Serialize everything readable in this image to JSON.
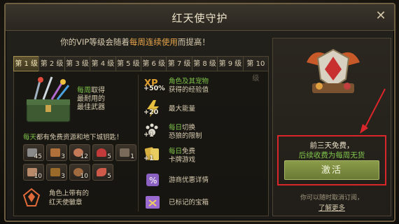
{
  "window": {
    "title": "红天使守护"
  },
  "subtitle": {
    "prefix": "你的VIP等级会随着",
    "highlight": "每周连续使用",
    "suffix": "而提高！"
  },
  "tabs": [
    {
      "label": "第 1 级",
      "active": true
    },
    {
      "label": "第 2 级",
      "active": false
    },
    {
      "label": "第 3 级",
      "active": false
    },
    {
      "label": "第 4 级",
      "active": false
    },
    {
      "label": "第 5 级",
      "active": false
    },
    {
      "label": "第 6 级",
      "active": false
    },
    {
      "label": "第 7 级",
      "active": false
    },
    {
      "label": "第 8 级",
      "active": false
    },
    {
      "label": "第 9 级",
      "active": false
    },
    {
      "label": "第 10 级",
      "active": false
    }
  ],
  "weapon": {
    "highlight": "每周",
    "line1": "取得",
    "line2": "最耐用的",
    "line3": "最佳武器"
  },
  "daily": {
    "highlight": "每天",
    "text": "都有免费资源和地下城钥匙！"
  },
  "resources": [
    {
      "amount": "45",
      "color": "#8a8a8a",
      "icon": "stone-icon"
    },
    {
      "amount": "3",
      "color": "#b0703a",
      "icon": "wood-plank-icon"
    },
    {
      "amount": "12",
      "color": "#c47a58",
      "icon": "meat-icon"
    },
    {
      "amount": "5",
      "color": "#c23a3a",
      "icon": "red-mushroom-icon"
    },
    {
      "amount": "1",
      "color": "#7a6a5a",
      "icon": "dungeon-key-icon"
    },
    {
      "amount": "10",
      "color": "#b88a6a",
      "icon": "brick-icon"
    },
    {
      "amount": "3",
      "color": "#9a6a2a",
      "icon": "leather-icon"
    },
    {
      "amount": "10",
      "color": "#a06a40",
      "icon": "pot-icon"
    },
    {
      "amount": "5",
      "color": "#d05a4a",
      "icon": "fish-icon"
    }
  ],
  "badge": {
    "line1": "角色上带有的",
    "line2": "红天使徽章"
  },
  "benefits": [
    {
      "value": "+50%",
      "icon": "xp-icon",
      "highlight": "角色及其宠物",
      "text": "获得的经验值"
    },
    {
      "value": "+20",
      "icon": "lightning-energy-icon",
      "highlight": "",
      "text": "最大能量"
    },
    {
      "value": "+1",
      "icon": "wolf-paw-icon",
      "highlight": "每日",
      "highlight_suffix": "切换",
      "text": "恐狼的限制"
    },
    {
      "value": "+1",
      "icon": "cards-icon",
      "highlight": "每日",
      "highlight_suffix": "免费",
      "text": "卡牌游戏"
    },
    {
      "value": "",
      "icon": "trade-icon",
      "highlight": "",
      "text": "游商优惠详情"
    },
    {
      "value": "",
      "icon": "treasure-map-icon",
      "highlight": "",
      "text": "已标记的宝箱"
    }
  ],
  "offer": {
    "line1": "前三天免费，",
    "line2": "后续收费为每周无货",
    "activate_label": "激活",
    "cancel_note": "你可以随时取消订阅，",
    "learn_more": "了解更多"
  },
  "colors": {
    "accent_green": "#7fc54a",
    "accent_orange": "#e9a64a",
    "highlight_red": "#d8262a"
  }
}
